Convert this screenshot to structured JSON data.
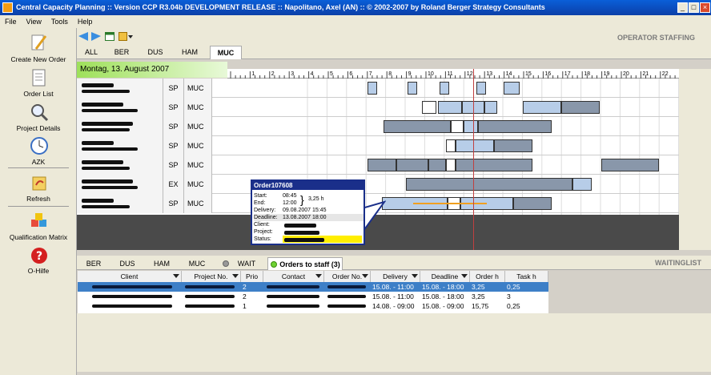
{
  "window": {
    "title": "Central Capacity Planning :: Version CCP R3.04b DEVELOPMENT RELEASE :: Napolitano, Axel (AN) :: © 2002-2007 by Roland Berger Strategy Consultants",
    "minimize": "_",
    "maximize": "□",
    "close": "×"
  },
  "menu": [
    "File",
    "View",
    "Tools",
    "Help"
  ],
  "sidebar": [
    {
      "label": "Create New Order",
      "icon": "pencil-icon"
    },
    {
      "label": "Order List",
      "icon": "document-icon"
    },
    {
      "label": "Project Details",
      "icon": "magnifier-icon"
    },
    {
      "label": "AZK",
      "icon": "clock-icon"
    },
    {
      "label": "Refresh",
      "icon": "refresh-icon"
    },
    {
      "label": "Qualification Matrix",
      "icon": "cubes-icon"
    },
    {
      "label": "O-Hilfe",
      "icon": "help-icon"
    }
  ],
  "header": {
    "operator_staffing": "OPERATOR STAFFING"
  },
  "tabs_top": [
    {
      "label": "ALL",
      "active": false
    },
    {
      "label": "BER",
      "active": false
    },
    {
      "label": "DUS",
      "active": false
    },
    {
      "label": "HAM",
      "active": false
    },
    {
      "label": "MUC",
      "active": true
    }
  ],
  "date": "Montag, 13. August 2007",
  "ruler_hours": [
    "1",
    "2",
    "3",
    "4",
    "5",
    "6",
    "7",
    "8",
    "9",
    "10",
    "11",
    "12",
    "13",
    "14",
    "15",
    "16",
    "17",
    "18",
    "19",
    "20",
    "21",
    "22",
    "23"
  ],
  "rows": [
    {
      "type": "SP",
      "loc": "MUC"
    },
    {
      "type": "SP",
      "loc": "MUC"
    },
    {
      "type": "SP",
      "loc": "MUC"
    },
    {
      "type": "SP",
      "loc": "MUC"
    },
    {
      "type": "SP",
      "loc": "MUC"
    },
    {
      "type": "EX",
      "loc": "MUC"
    },
    {
      "type": "SP",
      "loc": "MUC"
    }
  ],
  "popup": {
    "title": "Order107608",
    "start_label": "Start:",
    "start": "08:45",
    "end_label": "End:",
    "end": "12:00",
    "duration": "3,25 h",
    "delivery_label": "Delivery:",
    "delivery": "09.08.2007 15:45",
    "deadline_label": "Deadline:",
    "deadline": "13.08.2007 18:00",
    "client_label": "Client:",
    "project_label": "Project:",
    "status_label": "Status:"
  },
  "tabs_bottom": [
    {
      "label": "BER"
    },
    {
      "label": "DUS"
    },
    {
      "label": "HAM"
    },
    {
      "label": "MUC"
    },
    {
      "label": "WAIT"
    },
    {
      "label": "Orders to staff (3)"
    }
  ],
  "waitinglist": "WAITINGLIST",
  "table": {
    "headers": [
      "Client",
      "Project No.",
      "Prio",
      "Contact",
      "Order No.",
      "Delivery",
      "Deadline",
      "Order h",
      "Task h"
    ],
    "rows": [
      {
        "prio": "2",
        "delivery": "15.08. - 11:00",
        "deadline": "15.08. - 18:00",
        "order_h": "3,25",
        "task_h": "0,25",
        "selected": true
      },
      {
        "prio": "2",
        "delivery": "15.08. - 11:00",
        "deadline": "15.08. - 18:00",
        "order_h": "3,25",
        "task_h": "3",
        "selected": false
      },
      {
        "prio": "1",
        "delivery": "14.08. - 09:00",
        "deadline": "15.08. - 09:00",
        "order_h": "15,75",
        "task_h": "0,25",
        "selected": false
      }
    ]
  },
  "colors": {
    "title_bar": "#0b3fa8",
    "date_band": "#9ee05a",
    "selected_row": "#3d7fc7",
    "bar_light": "#b7cde8",
    "bar_dark": "#8997aa",
    "status_yellow": "#ffee00"
  }
}
